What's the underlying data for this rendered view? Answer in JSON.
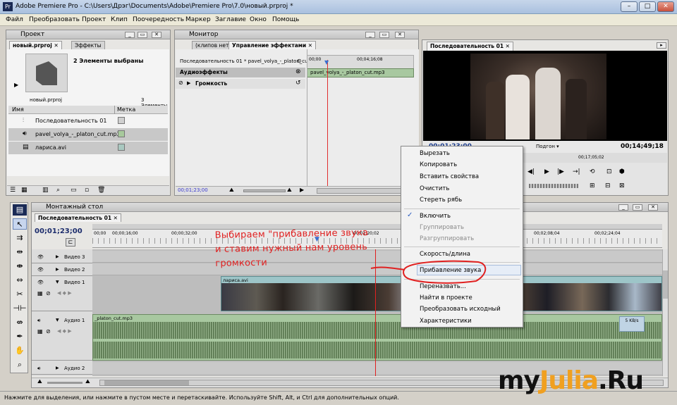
{
  "window": {
    "title": "Adobe Premiere Pro - C:\\Users\\Дрэг\\Documents\\Adobe\\Premiere Pro\\7.0\\новый.prproj *"
  },
  "menu": [
    "Файл",
    "Преобразовать",
    "Проект",
    "Клип",
    "Поочередность",
    "Маркер",
    "Заглавие",
    "Окно",
    "Помощь"
  ],
  "project": {
    "panel_title": "Проект",
    "tabs": [
      "новый.prproj",
      "Эффекты"
    ],
    "selected_info": "2 Элементы выбраны",
    "file_name": "новый.prproj",
    "count": "3 Элементы",
    "col_name": "Имя",
    "col_label": "Метка",
    "items": [
      "Последовательность 01",
      "pavel_volya_-_platon_cut.mp3",
      "лариса.avi"
    ]
  },
  "monitor": {
    "panel_title": "Монитор",
    "tabs": [
      "(клипов нет)",
      "Управление эффектами"
    ],
    "seq_label": "Последовательность 01 * pavel_volya_-_platon_cut.mp3",
    "tc_left": "00;00",
    "tc_right": "00;04;16;08",
    "clip_name": "pavel_volya_-_platon_cut.mp3",
    "audio_effects": "Аудиоэффекты",
    "volume": "Громкость",
    "timecode": "00;01;23;00"
  },
  "program": {
    "tab": "Последовательность 01",
    "timecode_left": "00;01;23;00",
    "fit": "Подгон",
    "timecode_right": "00;14;49;18",
    "ruler_mark": "00;17;05;02"
  },
  "timeline": {
    "panel_title": "Монтажный стол",
    "tab": "Последовательность 01",
    "timecode": "00;01;23;00",
    "ruler": [
      "00;00",
      "00;00;16;00",
      "00;00;32;00",
      "00;01;20;02",
      "00;02;08;04",
      "00;02;24;04"
    ],
    "tracks": [
      "Видео 3",
      "Видео 2",
      "Видео 1",
      "Аудио 1",
      "Аудио 2"
    ],
    "video_clip": "лариса.avi",
    "audio_clip": "_platon_cut.mp3",
    "annotation": "Выбираем \"прибавление звука и ставим нужный нам уровень громкости",
    "badge": "5 KB/s"
  },
  "context_menu": {
    "items": [
      {
        "label": "Вырезать",
        "disabled": false,
        "checked": false
      },
      {
        "label": "Копировать",
        "disabled": false,
        "checked": false
      },
      {
        "label": "Вставить свойства",
        "disabled": false,
        "checked": false
      },
      {
        "label": "Очистить",
        "disabled": false,
        "checked": false
      },
      {
        "label": "Стереть рябь",
        "disabled": false,
        "checked": false
      },
      {
        "label": "Включить",
        "disabled": false,
        "checked": true
      },
      {
        "label": "Группировать",
        "disabled": true,
        "checked": false
      },
      {
        "label": "Разгруппировать",
        "disabled": true,
        "checked": false
      },
      {
        "label": "Скорость/длина",
        "disabled": false,
        "checked": false
      },
      {
        "label": "Прибавление звука",
        "disabled": false,
        "checked": false,
        "highlighted": true
      },
      {
        "label": "Переназвать...",
        "disabled": false,
        "checked": false
      },
      {
        "label": "Найти в проекте",
        "disabled": false,
        "checked": false
      },
      {
        "label": "Преобразовать исходный",
        "disabled": false,
        "checked": false
      },
      {
        "label": "Характеристики",
        "disabled": false,
        "checked": false
      }
    ]
  },
  "status": "Нажмите для выделения, или нажмите в пустом месте и перетаскивайте. Используйте Shift, Alt, и Ctrl для дополнительных опций.",
  "watermark": "myJulia.Ru",
  "colors": {
    "accent": "#e02020",
    "playhead": "#c0392b",
    "audio_wave": "#6c8a62",
    "video_strip": "#9dc5c8",
    "audio_strip": "#a8c8a0"
  }
}
